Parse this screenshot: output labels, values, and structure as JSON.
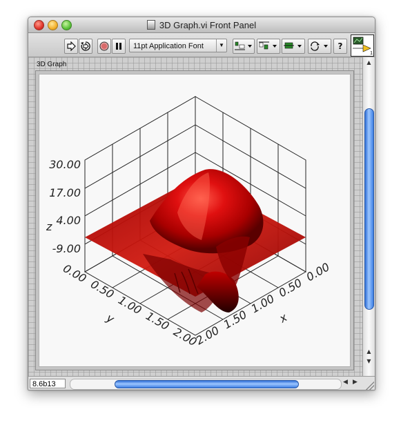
{
  "window": {
    "title": "3D Graph.vi Front Panel"
  },
  "toolbar": {
    "run_icon": "run-arrow-icon",
    "run_continuous_icon": "run-continuously-icon",
    "abort_icon": "abort-icon",
    "pause_icon": "pause-icon",
    "font_select": "11pt Application Font",
    "align_icon": "align-objects-icon",
    "distribute_icon": "distribute-objects-icon",
    "resize_icon": "resize-objects-icon",
    "reorder_icon": "reorder-icon",
    "help_button": "?",
    "vi_icon_number": "1"
  },
  "graph": {
    "label": "3D Graph",
    "surface_color": "#cc0000",
    "z_axis": {
      "name": "z",
      "ticks": [
        "30.00",
        "17.00",
        "4.00",
        "-9.00"
      ]
    },
    "y_axis": {
      "name": "y",
      "ticks": [
        "0.00",
        "0.50",
        "1.00",
        "1.50",
        "2.00"
      ]
    },
    "x_axis": {
      "name": "x",
      "ticks": [
        "0.00",
        "0.50",
        "1.00",
        "1.50",
        "2.00"
      ]
    }
  },
  "status": {
    "version": "8.6b13"
  }
}
